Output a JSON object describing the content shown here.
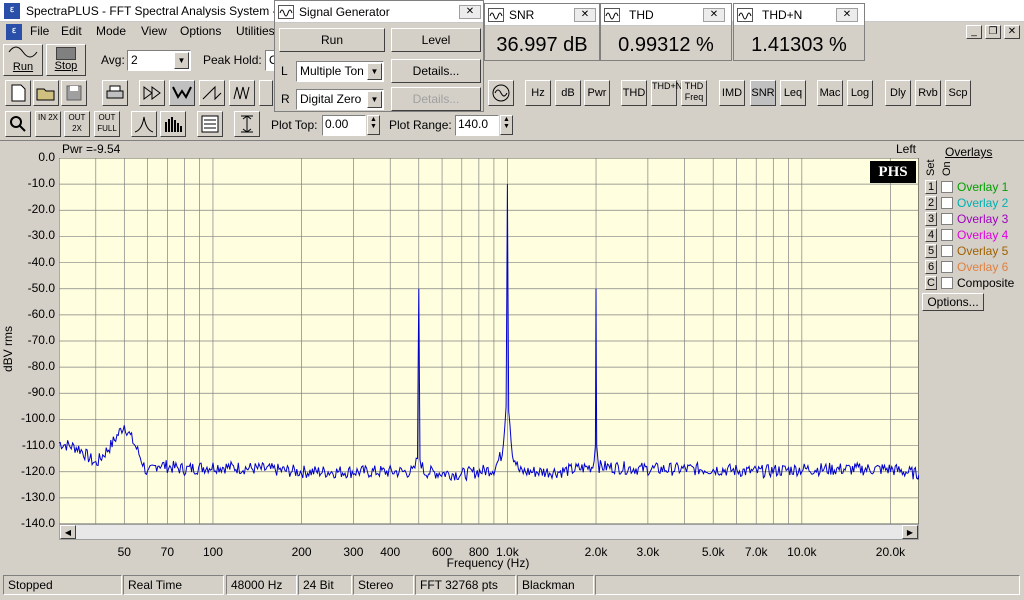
{
  "window": {
    "title": "SpectraPLUS - FFT Spectral Analysis System - [S"
  },
  "menu": [
    "File",
    "Edit",
    "Mode",
    "View",
    "Options",
    "Utilities"
  ],
  "toolbar": {
    "run_label": "Run",
    "stop_label": "Stop",
    "avg_label": "Avg:",
    "avg_value": "2",
    "peak_hold_label": "Peak Hold:",
    "peak_hold_value": "O",
    "plot_top_label": "Plot Top:",
    "plot_top_value": "0.00",
    "plot_range_label": "Plot Range:",
    "plot_range_value": "140.0",
    "row2_buttons": [
      "Hz",
      "dB",
      "Pwr",
      "THD",
      "THD+N",
      "THD Freq",
      "IMD",
      "SNR",
      "Leq",
      "Mac",
      "Log",
      "Dly",
      "Rvb",
      "Scp"
    ],
    "zoom_buttons": [
      "IN 2X",
      "OUT 2X",
      "OUT FULL"
    ]
  },
  "siggen": {
    "title": "Signal Generator",
    "run_label": "Run",
    "level_label": "Level",
    "left_channel": "L",
    "right_channel": "R",
    "left_mode": "Multiple Ton",
    "right_mode": "Digital Zero",
    "details_label": "Details...",
    "details_disabled_label": "Details..."
  },
  "meters": [
    {
      "name": "SNR",
      "value": "36.997 dB"
    },
    {
      "name": "THD",
      "value": "0.99312 %"
    },
    {
      "name": "THD+N",
      "value": "1.41303 %"
    }
  ],
  "plot": {
    "pwr_readout": "Pwr =-9.54",
    "channel_label": "Left",
    "logo": "PHS",
    "ylabel": "dBV rms",
    "xlabel": "Frequency (Hz)",
    "background": "#ffffe0",
    "trace_color": "#0000cc"
  },
  "chart_data": {
    "type": "line",
    "xlabel": "Frequency (Hz)",
    "ylabel": "dBV rms",
    "xscale": "log",
    "xlim": [
      30,
      25000
    ],
    "ylim": [
      -140,
      0
    ],
    "yticks": [
      "0.0",
      "-10.0",
      "-20.0",
      "-30.0",
      "-40.0",
      "-50.0",
      "-60.0",
      "-70.0",
      "-80.0",
      "-90.0",
      "-100.0",
      "-110.0",
      "-120.0",
      "-130.0",
      "-140.0"
    ],
    "xticks": [
      {
        "v": 50,
        "t": "50"
      },
      {
        "v": 70,
        "t": "70"
      },
      {
        "v": 100,
        "t": "100"
      },
      {
        "v": 200,
        "t": "200"
      },
      {
        "v": 300,
        "t": "300"
      },
      {
        "v": 400,
        "t": "400"
      },
      {
        "v": 600,
        "t": "600"
      },
      {
        "v": 800,
        "t": "800"
      },
      {
        "v": 1000,
        "t": "1.0k"
      },
      {
        "v": 2000,
        "t": "2.0k"
      },
      {
        "v": 3000,
        "t": "3.0k"
      },
      {
        "v": 5000,
        "t": "5.0k"
      },
      {
        "v": 7000,
        "t": "7.0k"
      },
      {
        "v": 10000,
        "t": "10.0k"
      },
      {
        "v": 20000,
        "t": "20.0k"
      }
    ],
    "series": [
      {
        "x": [
          30,
          35,
          40,
          45,
          50,
          55,
          60,
          65,
          70,
          80,
          100,
          150,
          200,
          300,
          400,
          480,
          495,
          500,
          505,
          520,
          700,
          900,
          960,
          990,
          1000,
          1010,
          1040,
          1100,
          1500,
          1950,
          1990,
          2000,
          2010,
          2050,
          3000,
          5000,
          7000,
          10000,
          15000,
          20000,
          25000
        ],
        "y": [
          -109,
          -111,
          -117,
          -110,
          -102,
          -111,
          -121,
          -117,
          -118,
          -119,
          -118,
          -119,
          -120,
          -120,
          -120,
          -120,
          -115,
          -50,
          -115,
          -120,
          -121,
          -119,
          -113,
          -95,
          -10,
          -95,
          -113,
          -120,
          -120,
          -118,
          -110,
          -50,
          -110,
          -118,
          -119,
          -119,
          -120,
          -119,
          -119,
          -119,
          -121
        ]
      }
    ]
  },
  "overlays": {
    "title": "Overlays",
    "set_label": "Set",
    "on_label": "On",
    "items": [
      {
        "num": "1",
        "label": "Overlay 1",
        "color": "#00a000"
      },
      {
        "num": "2",
        "label": "Overlay 2",
        "color": "#00b0b0"
      },
      {
        "num": "3",
        "label": "Overlay 3",
        "color": "#a000c0"
      },
      {
        "num": "4",
        "label": "Overlay 4",
        "color": "#e000e0"
      },
      {
        "num": "5",
        "label": "Overlay 5",
        "color": "#a06000"
      },
      {
        "num": "6",
        "label": "Overlay 6",
        "color": "#e08040"
      },
      {
        "num": "C",
        "label": "Composite",
        "color": "#000000"
      }
    ],
    "options_label": "Options..."
  },
  "status": [
    "Stopped",
    "Real Time",
    "48000 Hz",
    "24 Bit",
    "Stereo",
    "FFT 32768 pts",
    "Blackman"
  ]
}
